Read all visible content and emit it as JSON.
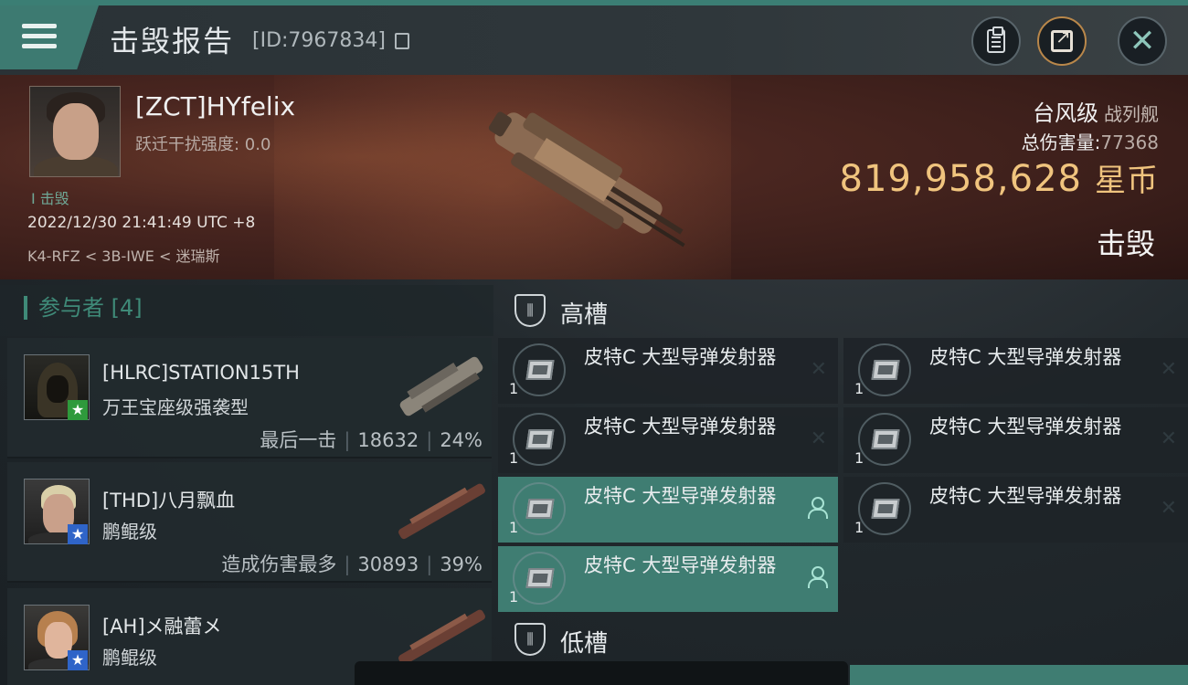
{
  "header": {
    "title": "击毁报告",
    "report_id": "[ID:7967834]"
  },
  "victim": {
    "name": "[ZCT]HYfelix",
    "warp_label": "跃迁干扰强度: 0.0",
    "kill_tag": "I 击毁",
    "time": "2022/12/30 21:41:49 UTC +8",
    "location": "K4-RFZ < 3B-IWE < 迷瑞斯",
    "ship_name": "台风级",
    "ship_type": "战列舰",
    "total_damage_label": "总伤害量:",
    "total_damage_value": "77368",
    "isk_value": "819,958,628",
    "isk_unit": "星币",
    "status": "击毁"
  },
  "participants": {
    "title": "参与者 [4]",
    "rows": [
      {
        "name": "[HLRC]STATION15TH",
        "ship": "万王宝座级强袭型",
        "stat_label": "最后一击",
        "damage": "18632",
        "percent": "24%",
        "badge_color": "#2f9a3c",
        "badge_icon": "star"
      },
      {
        "name": "[THD]八月飘血",
        "ship": "鹏鲲级",
        "stat_label": "造成伤害最多",
        "damage": "30893",
        "percent": "39%",
        "badge_color": "#2f64c8",
        "badge_icon": "star"
      },
      {
        "name": "[AH]メ融蕾メ",
        "ship": "鹏鲲级",
        "stat_label": "",
        "damage": "",
        "percent": "",
        "badge_color": "#2f64c8",
        "badge_icon": "star"
      }
    ]
  },
  "fitting": {
    "high_label": "高槽",
    "low_label": "低槽",
    "high_modules": [
      {
        "name": "皮特C 大型导弹发射器",
        "qty": "1",
        "state": "destroyed"
      },
      {
        "name": "皮特C 大型导弹发射器",
        "qty": "1",
        "state": "destroyed"
      },
      {
        "name": "皮特C 大型导弹发射器",
        "qty": "1",
        "state": "destroyed"
      },
      {
        "name": "皮特C 大型导弹发射器",
        "qty": "1",
        "state": "destroyed"
      },
      {
        "name": "皮特C 大型导弹发射器",
        "qty": "1",
        "state": "dropped"
      },
      {
        "name": "皮特C 大型导弹发射器",
        "qty": "1",
        "state": "destroyed"
      },
      {
        "name": "皮特C 大型导弹发射器",
        "qty": "1",
        "state": "dropped"
      }
    ]
  },
  "colors": {
    "accent": "#3f7d72",
    "isk": "#f0c47e",
    "banner": "#4a2620"
  },
  "icons": {
    "menu": "hamburger-icon",
    "copy": "copy-icon",
    "clipboard": "clipboard-icon",
    "share": "share-icon",
    "close": "close-icon",
    "slot": "shield-slot-icon",
    "module": "missile-launcher-icon",
    "destroyed": "x-mark-icon",
    "dropped": "person-icon"
  }
}
